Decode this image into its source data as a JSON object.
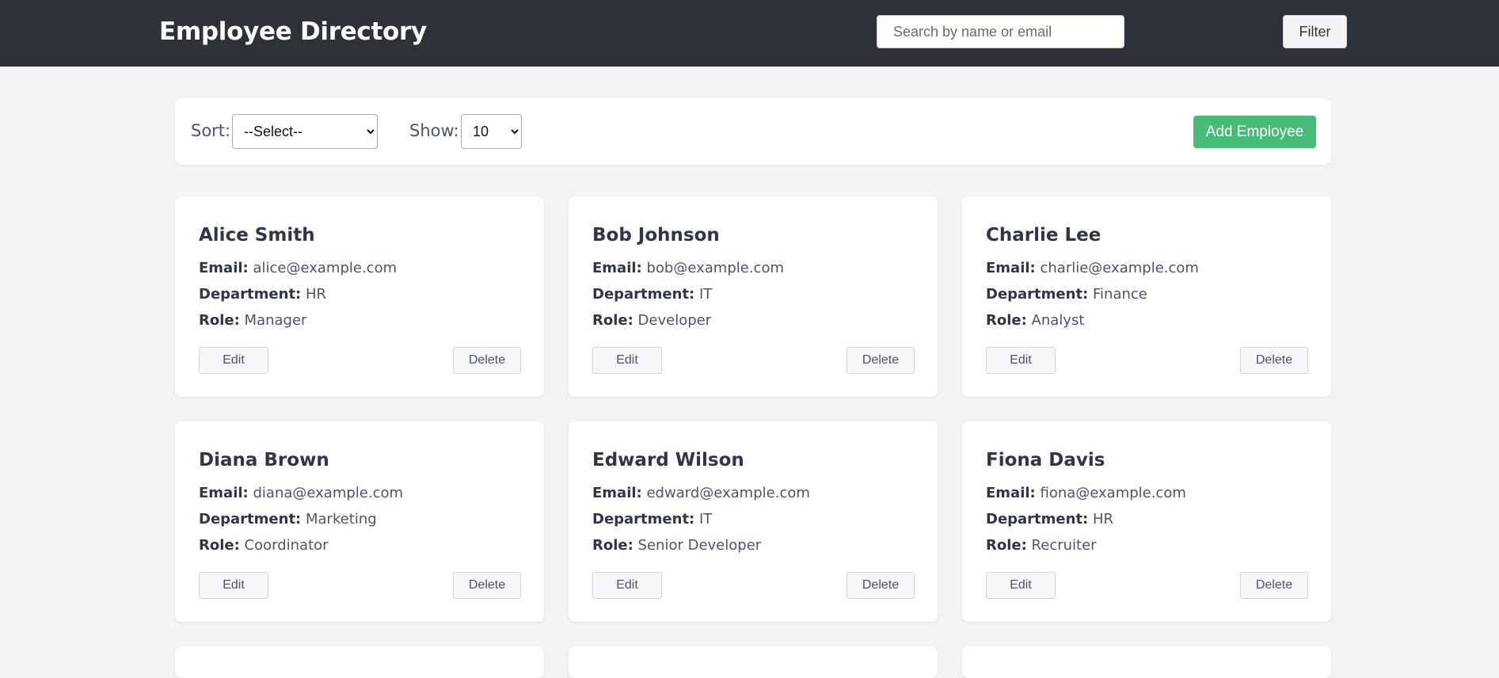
{
  "header": {
    "title": "Employee Directory",
    "search_placeholder": "Search by name or email",
    "filter_label": "Filter"
  },
  "toolbar": {
    "sort_label": "Sort:",
    "sort_selected": "--Select--",
    "show_label": "Show:",
    "show_selected": "10",
    "add_label": "Add Employee"
  },
  "field_labels": {
    "email": "Email:",
    "department": "Department:",
    "role": "Role:"
  },
  "card_actions": {
    "edit": "Edit",
    "delete": "Delete"
  },
  "employees": [
    {
      "name": "Alice Smith",
      "email": "alice@example.com",
      "department": "HR",
      "role": "Manager"
    },
    {
      "name": "Bob Johnson",
      "email": "bob@example.com",
      "department": "IT",
      "role": "Developer"
    },
    {
      "name": "Charlie Lee",
      "email": "charlie@example.com",
      "department": "Finance",
      "role": "Analyst"
    },
    {
      "name": "Diana Brown",
      "email": "diana@example.com",
      "department": "Marketing",
      "role": "Coordinator"
    },
    {
      "name": "Edward Wilson",
      "email": "edward@example.com",
      "department": "IT",
      "role": "Senior Developer"
    },
    {
      "name": "Fiona Davis",
      "email": "fiona@example.com",
      "department": "HR",
      "role": "Recruiter"
    }
  ],
  "colors": {
    "header_bg": "#2d3238",
    "page_bg": "#f4f4f4",
    "accent_green": "#48bb78"
  }
}
